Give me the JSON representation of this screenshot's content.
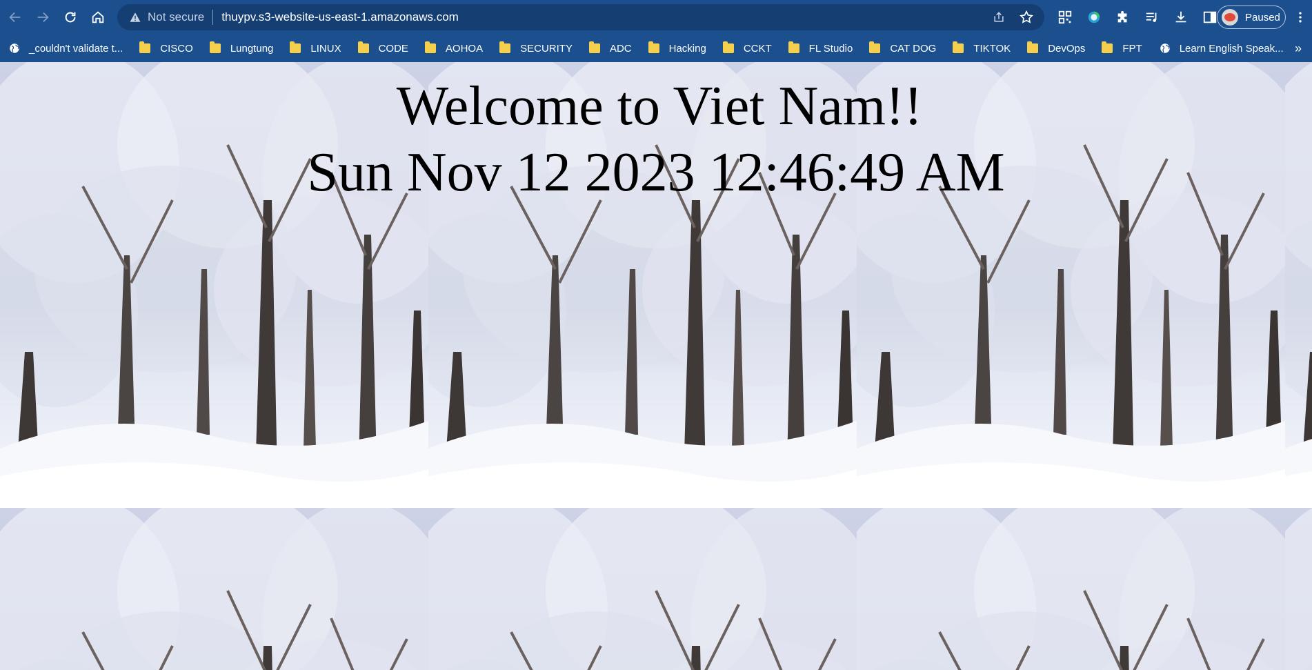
{
  "browser": {
    "security_label": "Not secure",
    "url": "thuypv.s3-website-us-east-1.amazonaws.com",
    "profile_label": "Paused",
    "colors": {
      "toolbar": "#1b4f8e",
      "omnibox": "#153e73"
    }
  },
  "bookmarks": [
    {
      "label": "_couldn't validate t...",
      "icon": "globe-icon"
    },
    {
      "label": "CISCO",
      "icon": "folder-icon"
    },
    {
      "label": "Lungtung",
      "icon": "folder-icon"
    },
    {
      "label": "LINUX",
      "icon": "folder-icon"
    },
    {
      "label": "CODE",
      "icon": "folder-icon"
    },
    {
      "label": "AOHOA",
      "icon": "folder-icon"
    },
    {
      "label": "SECURITY",
      "icon": "folder-icon"
    },
    {
      "label": "ADC",
      "icon": "folder-icon"
    },
    {
      "label": "Hacking",
      "icon": "folder-icon"
    },
    {
      "label": "CCKT",
      "icon": "folder-icon"
    },
    {
      "label": "FL Studio",
      "icon": "folder-icon"
    },
    {
      "label": "CAT DOG",
      "icon": "folder-icon"
    },
    {
      "label": "TIKTOK",
      "icon": "folder-icon"
    },
    {
      "label": "DevOps",
      "icon": "folder-icon"
    },
    {
      "label": "FPT",
      "icon": "folder-icon"
    },
    {
      "label": "Learn English Speak...",
      "icon": "globe-icon"
    }
  ],
  "page": {
    "heading": "Welcome to Viet Nam!!",
    "datetime": "Sun Nov 12 2023 12:46:49 AM"
  }
}
